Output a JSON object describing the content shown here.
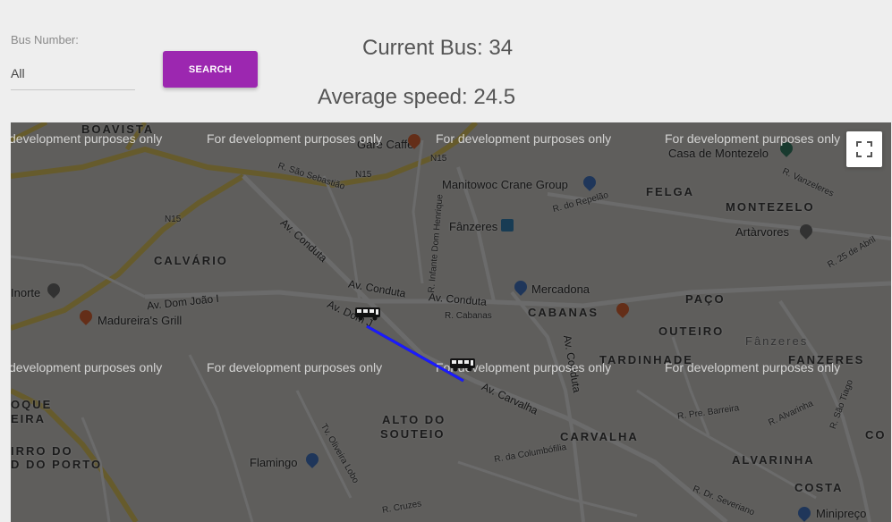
{
  "form": {
    "bus_number_label": "Bus Number:",
    "bus_number_value": "All",
    "search_label": "SEARCH"
  },
  "stats": {
    "current_bus": "Current Bus: 34",
    "average_speed": "Average speed: 24.5"
  },
  "map": {
    "watermark": "For development purposes only",
    "watermark_partial": "development purposes only",
    "fullscreen_icon": "fullscreen-icon",
    "bus_icon": "bus-icon",
    "route_color": "#1a1aff",
    "places": {
      "boavista": "BOAVISTA",
      "calvario": "CALVÁRIO",
      "felga": "FELGA",
      "montezelo": "MONTEZELO",
      "paco": "PAÇO",
      "cabanas": "CABANAS",
      "outeiro": "OUTEIRO",
      "tardinhade": "TARDINHADE",
      "fanzeres_caps": "FANZERES",
      "fanzeres_light": "Fânzeres",
      "alto_do_souteio_1": "ALTO DO",
      "alto_do_souteio_2": "SOUTEIO",
      "carvalha": "CARVALHA",
      "alvarinha": "ALVARINHA",
      "costa": "COSTA",
      "eira": "EIRA",
      "oque": "OQUE",
      "bairro_do": "IRRO DO",
      "do_porto": "D DO PORTO",
      "co": "CO"
    },
    "pois": {
      "gare_cafe": "Gare Caffè",
      "manitowoc": "Manitowoc Crane Group",
      "fanzeres_metro": "Fânzeres",
      "mercadona": "Mercadona",
      "artavores": "Artàrvores",
      "casa_montezelo": "Casa de Montezelo",
      "madureira": "Madureira's Grill",
      "inorte": "Inorte",
      "flamingo": "Flamingo",
      "minipreco": "Minipreço"
    },
    "roads": {
      "n15_a": "N15",
      "n15_b": "N15",
      "n15_c": "N15",
      "av_conduta_1": "Av. Conduta",
      "av_conduta_2": "Av. Conduta",
      "av_conduta_3": "Av. Conduta",
      "av_conduta_4": "Av. Conduta",
      "av_dom_joao": "Av. Dom João I",
      "av_dom_joao_2": "Av. Dom J",
      "av_carvalha": "Av. Carvalha",
      "r_sao_sebastiao": "R. São Sebastião",
      "r_do_repelao": "R. do Repelão",
      "r_cabanas": "R. Cabanas",
      "r_sao_tiago": "R. São Tiago",
      "r_25_abril": "R. 25 de Abril",
      "r_vanzeleres": "R. Vanzeleres",
      "r_pre_barreira": "R. Pre. Barreira",
      "r_alvarinha": "R. Alvarinha",
      "r_dr_severiano": "R. Dr. Severiano",
      "r_cruzes": "R. Cruzes",
      "r_da_columbofilia": "R. da Columbófilia",
      "r_infante": "R. Infante Dom Henrique",
      "tv_oliveira_lobo": "Tv. Oliveira Lobo"
    }
  }
}
